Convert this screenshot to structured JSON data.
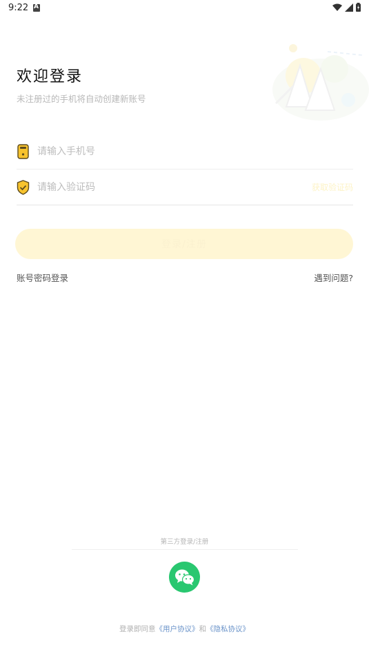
{
  "status_bar": {
    "time": "9:22",
    "indicator": "A"
  },
  "header": {
    "title": "欢迎登录",
    "subtitle": "未注册过的手机将自动创建新账号"
  },
  "form": {
    "phone": {
      "placeholder": "请输入手机号",
      "value": "",
      "icon": "phone-icon"
    },
    "code": {
      "placeholder": "请输入验证码",
      "value": "",
      "icon": "shield-check-icon",
      "action_label": "获取验证码"
    },
    "submit_label": "登录/注册"
  },
  "links": {
    "password_login": "账号密码登录",
    "help": "遇到问题?"
  },
  "third_party": {
    "label": "第三方登录/注册",
    "wechat_icon": "wechat-icon"
  },
  "agreement": {
    "prefix": "登录即同意",
    "user_agreement": "《用户协议》",
    "and": "和",
    "privacy_policy": "《隐私协议》"
  },
  "colors": {
    "accent": "#f7c32e",
    "button_bg": "#fff6d4",
    "wechat": "#29c770",
    "link": "#6a93c9"
  }
}
